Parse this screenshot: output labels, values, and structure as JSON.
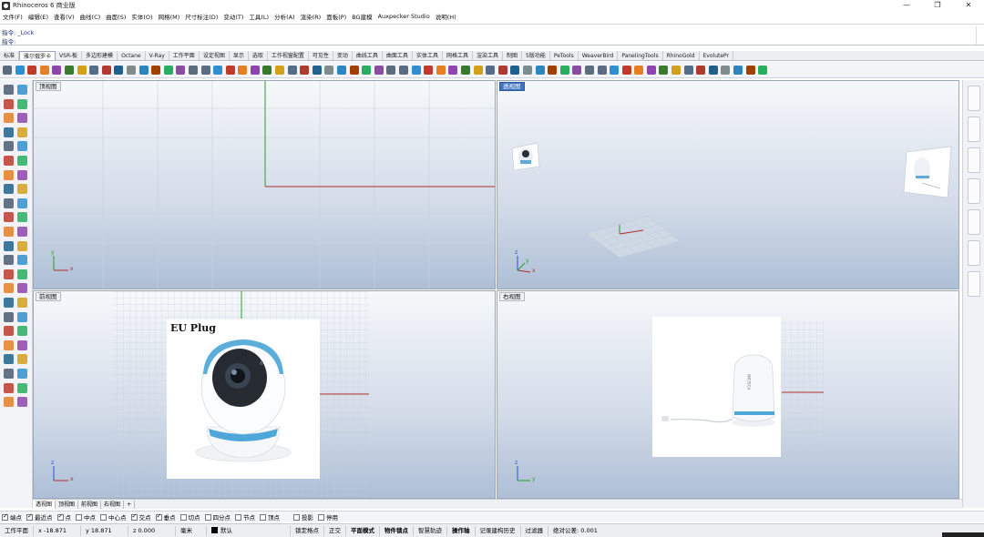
{
  "window": {
    "title": "Rhinoceros 6 商业版",
    "controls": [
      "—",
      "❐",
      "✕"
    ]
  },
  "menu": [
    "文件(F)",
    "编辑(E)",
    "查看(V)",
    "曲线(C)",
    "曲面(S)",
    "实体(O)",
    "网格(M)",
    "尺寸标注(D)",
    "变动(T)",
    "工具(L)",
    "分析(A)",
    "渲染(R)",
    "面板(P)",
    "BG建模",
    "Auxpecker Studio",
    "说明(H)"
  ],
  "command": {
    "history": "指令: _Lock",
    "prompt": "指令:"
  },
  "tabs": [
    "标准",
    "雅尔俄罗卡",
    "VSR-板",
    "多边形建模",
    "Octane",
    "V-Ray",
    "工作平面",
    "设定视图",
    "显示",
    "选取",
    "工作视窗配置",
    "可见性",
    "变动",
    "曲线工具",
    "曲面工具",
    "实体工具",
    "网格工具",
    "渲染工具",
    "制图",
    "5版功能",
    "PeTools",
    "WeaverBird",
    "PanelingTools",
    "RhinoGold",
    "EvolutePr"
  ],
  "active_tab_index": 1,
  "viewports": {
    "top": {
      "label": "顶视图",
      "active": false
    },
    "perspective": {
      "label": "透视图",
      "active": true
    },
    "front": {
      "label": "前视图",
      "active": false,
      "photo_caption": "EU Plug"
    },
    "right": {
      "label": "右视图",
      "active": false,
      "photo_brand": "FOSCAM"
    }
  },
  "axis": {
    "x": "x",
    "y": "y",
    "z": "z"
  },
  "viewport_tabs": [
    "透视图",
    "顶视图",
    "前视图",
    "右视图",
    "+"
  ],
  "osnaps": [
    {
      "label": "端点",
      "checked": true
    },
    {
      "label": "最近点",
      "checked": true
    },
    {
      "label": "点",
      "checked": true
    },
    {
      "label": "中点",
      "checked": false
    },
    {
      "label": "中心点",
      "checked": false
    },
    {
      "label": "交点",
      "checked": true
    },
    {
      "label": "垂点",
      "checked": true
    },
    {
      "label": "切点",
      "checked": false
    },
    {
      "label": "四分点",
      "checked": false
    },
    {
      "label": "节点",
      "checked": false
    },
    {
      "label": "顶点",
      "checked": false
    },
    {
      "label": "投影",
      "checked": false
    },
    {
      "label": "停用",
      "checked": false
    }
  ],
  "status": {
    "cplane": "工作平面",
    "x": "x -18.871",
    "y": "y 18.871",
    "z": "z 0.000",
    "units": "毫米",
    "layer": "默认",
    "grid_snap": "锁定格点",
    "ortho": "正交",
    "planar": "平面模式",
    "osnap": "物件锁点",
    "smart_track": "智慧轨迹",
    "gumball": "操作轴",
    "history": "记录建构历史",
    "filter": "过滤器",
    "tolerance": "绝对公差: 0.001"
  },
  "colors": {
    "accent": "#3f74c4",
    "axis_x": "#b03030",
    "axis_y": "#2e9a2e",
    "axis_z": "#2f4fd0"
  }
}
